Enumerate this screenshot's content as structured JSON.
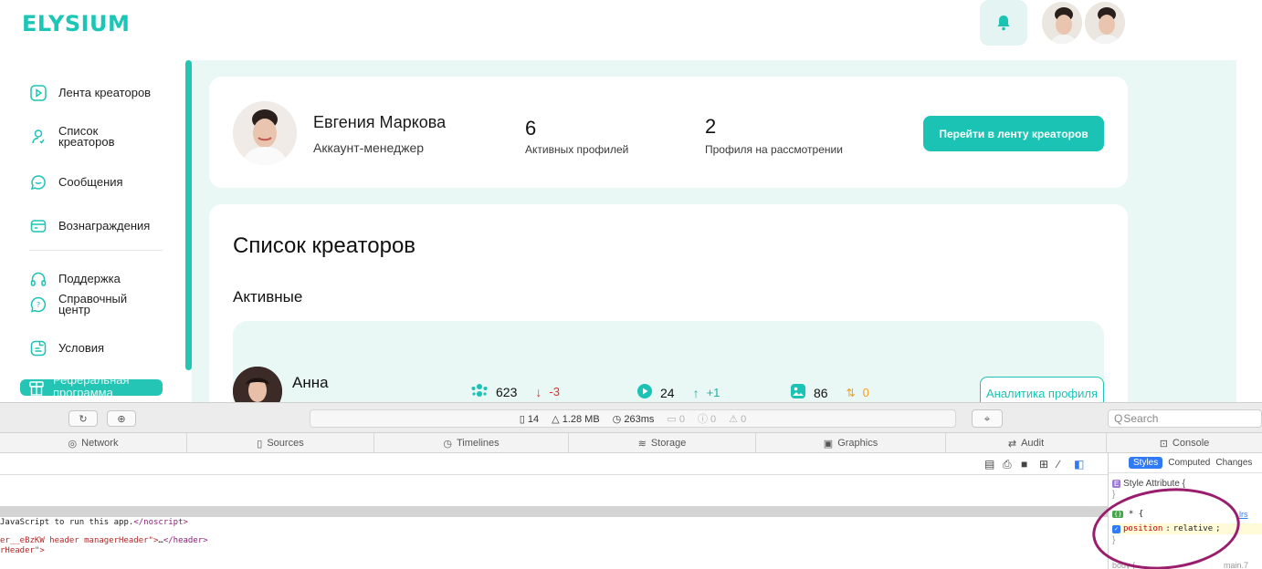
{
  "app": {
    "logo": "ELYSIUM",
    "colors": {
      "accent": "#1bc3b4",
      "accent_bg": "#e9f7f5",
      "negative": "#e0332e",
      "positive": "#1bb3a4",
      "neutral": "#f0a020"
    },
    "header": {
      "bell_icon": "bell-icon",
      "avatars": [
        "user-avatar",
        "user-avatar"
      ]
    }
  },
  "sidebar": {
    "items": [
      {
        "label": "Лента креаторов",
        "icon": "play-square-icon"
      },
      {
        "label_lines": [
          "Список",
          "креаторов"
        ],
        "icon": "user-icon"
      },
      {
        "label": "Сообщения",
        "icon": "chat-icon"
      },
      {
        "label": "Вознаграждения",
        "icon": "wallet-icon"
      },
      {
        "label": "Поддержка",
        "icon": "headphones-icon"
      },
      {
        "label_lines": [
          "Справочный",
          "центр"
        ],
        "icon": "help-chat-icon"
      },
      {
        "label": "Условия",
        "icon": "document-icon"
      }
    ],
    "active": {
      "label": "Реферальная программа",
      "icon": "gift-icon"
    }
  },
  "profile": {
    "name": "Евгения Маркова",
    "role": "Аккаунт-менеджер",
    "active_profiles_value": "6",
    "active_profiles_label": "Активных профилей",
    "review_value": "2",
    "review_label": "Профиля на рассмотрении",
    "cta": "Перейти в ленту креаторов"
  },
  "creators": {
    "title": "Список креаторов",
    "section": "Активные",
    "rows": [
      {
        "name": "Анна",
        "subscribers": "623",
        "subscribers_delta": "-3",
        "videos": "24",
        "videos_delta": "+1",
        "photos": "86",
        "photos_delta": "0",
        "button": "Аналитика профиля"
      }
    ]
  },
  "devtools": {
    "activity": {
      "requests": "14",
      "size": "1.28 MB",
      "time": "263ms",
      "logs": "0",
      "errors": "0",
      "warnings": "0"
    },
    "search_placeholder": "Search",
    "tabs": [
      "Network",
      "Sources",
      "Timelines",
      "Storage",
      "Graphics",
      "Audit",
      "Console"
    ],
    "code_lines": [
      {
        "text": "JavaScript to run this app.",
        "tag": "</noscript>"
      },
      {
        "prefix": "er__eBzKW header managerHeader\">",
        "mid": "…",
        "tag": "</header>"
      },
      {
        "text": "rHeader\">"
      }
    ],
    "styles": {
      "tabs": [
        "Styles",
        "Computed",
        "Changes"
      ],
      "style_attribute": "Style Attribute {",
      "close_brace": "}",
      "selector": "* {",
      "property": "position",
      "value": "relative",
      "source": "lrs",
      "body_selector": "body {",
      "body_source": "main.7"
    }
  }
}
